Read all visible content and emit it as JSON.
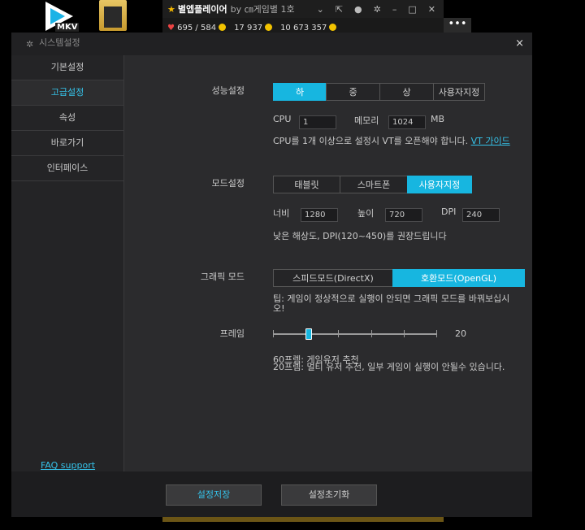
{
  "desktop": {
    "mkv_label": "MKV",
    "app_title": "별엡플레이어",
    "app_sub": "by ㎝게임별 1호",
    "stats": [
      "695 / 584",
      "17 937",
      "10 673 357"
    ],
    "more": "•••"
  },
  "dialog": {
    "title": "시스템설정",
    "close": "×"
  },
  "sidebar": {
    "items": [
      {
        "label": "기본설정"
      },
      {
        "label": "고급설정"
      },
      {
        "label": "속성"
      },
      {
        "label": "바로가기"
      },
      {
        "label": "인터페이스"
      }
    ],
    "faq": "FAQ support"
  },
  "performance": {
    "label": "성능설정",
    "options": [
      "하",
      "중",
      "상",
      "사용자지정"
    ],
    "selected": "하",
    "cpu_label": "CPU",
    "cpu_value": "1",
    "mem_label": "메모리",
    "mem_value": "1024",
    "mem_unit": "MB",
    "note": "CPU를 1개 이상으로 설정시 VT를 오픈해야 합니다.",
    "note_link": "VT 가이드"
  },
  "mode": {
    "label": "모드설정",
    "options": [
      "태블릿",
      "스마트폰",
      "사용자지정"
    ],
    "selected": "사용자지정",
    "width_label": "너비",
    "width_value": "1280",
    "height_label": "높이",
    "height_value": "720",
    "dpi_label": "DPI",
    "dpi_value": "240",
    "note": "낮은 해상도, DPI(120~450)를 권장드립니다"
  },
  "graphics": {
    "label": "그래픽 모드",
    "options": [
      "스피드모드(DirectX)",
      "호환모드(OpenGL)"
    ],
    "selected": "호환모드(OpenGL)",
    "tip": "팁: 게임이 정상적으로 실행이 안되면 그래픽 모드를 바꿔보십시오!"
  },
  "frame": {
    "label": "프레임",
    "value": "20",
    "note1": "60프렘: 게임유저 추천",
    "note2": "20프렘: 멀티 유저 추천, 일부 게임이 실행이 안될수 있습니다."
  },
  "footer": {
    "save": "설정저장",
    "reset": "설정초기화"
  }
}
